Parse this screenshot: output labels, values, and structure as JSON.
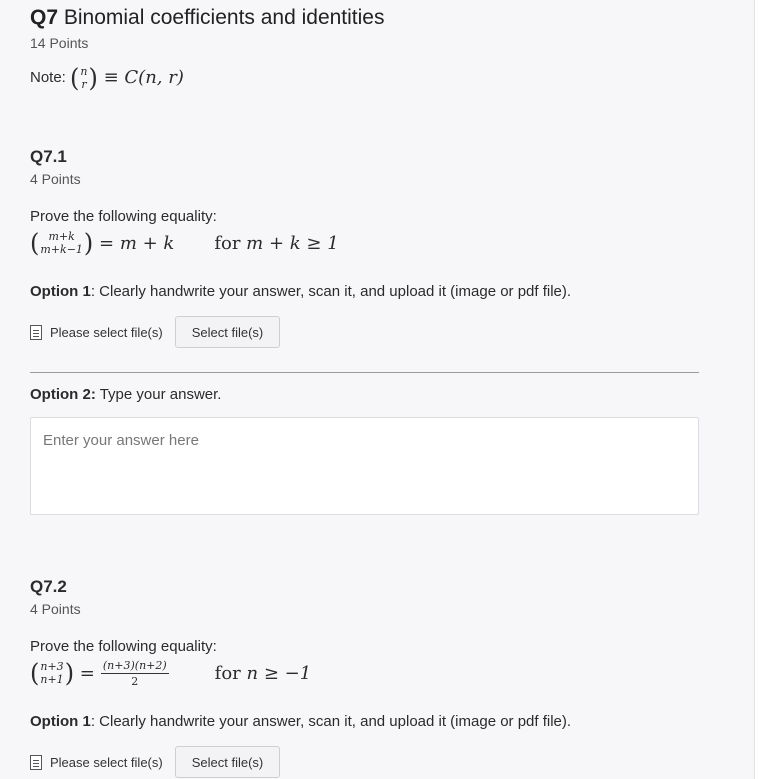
{
  "q7": {
    "num": "Q7",
    "title": "Binomial coefficients and identities",
    "points": "14 Points",
    "note_label": "Note:",
    "note_binom_top": "n",
    "note_binom_bottom": "r",
    "note_rhs": "≡ C(n, r)"
  },
  "q71": {
    "title": "Q7.1",
    "points": "4 Points",
    "prompt": "Prove the following equality:",
    "binom_top": "m+k",
    "binom_bottom": "m+k−1",
    "rhs": "= m + k",
    "for_word": "for",
    "condition": "m + k ≥ 1",
    "option1_label": "Option 1",
    "option1_text": ": Clearly handwrite your answer, scan it, and upload it (image or pdf file).",
    "please_select": "Please select file(s)",
    "select_button": "Select file(s)",
    "option2_label": "Option 2:",
    "option2_text": " Type your answer.",
    "answer_placeholder": "Enter your answer here"
  },
  "q72": {
    "title": "Q7.2",
    "points": "4 Points",
    "prompt": "Prove the following equality:",
    "binom_top": "n+3",
    "binom_bottom": "n+1",
    "eq": "=",
    "frac_num": "(n+3)(n+2)",
    "frac_den": "2",
    "for_word": "for",
    "condition": "n ≥ −1",
    "option1_label": "Option 1",
    "option1_text": ": Clearly handwrite your answer, scan it, and upload it (image or pdf file).",
    "please_select": "Please select file(s)",
    "select_button": "Select file(s)"
  },
  "icons": {
    "file": "file-icon"
  }
}
